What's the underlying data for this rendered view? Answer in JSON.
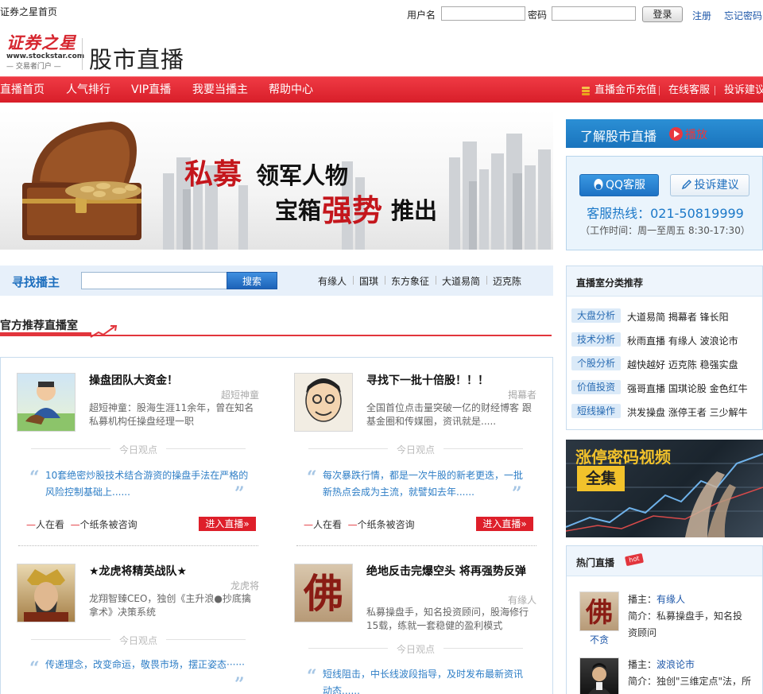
{
  "topbar": {
    "home_link": "证券之星首页",
    "username_label": "用户名",
    "password_label": "密码",
    "login_button": "登录",
    "register_link": "注册",
    "forgot_link": "忘记密码"
  },
  "header": {
    "logo_cn": "证券之星",
    "logo_url": "www.stockstar.com",
    "logo_sub": "— 交易者门户 —",
    "site_title": "股市直播"
  },
  "nav": {
    "items": [
      "直播首页",
      "人气排行",
      "VIP直播",
      "我要当播主",
      "帮助中心"
    ],
    "right_items": [
      "直播金币充值",
      "在线客服",
      "投诉建议"
    ]
  },
  "banner": {
    "line1_red": "私募",
    "line1_rest": "领军人物",
    "line2_a": "宝箱",
    "line2_red": "强势",
    "line2_b": "推出"
  },
  "search": {
    "label": "寻找播主",
    "input_value": "",
    "button": "搜索",
    "hot_keywords": [
      "有缘人",
      "国琪",
      "东方象征",
      "大道易简",
      "迈克陈"
    ]
  },
  "official": {
    "title": "官方推荐直播室",
    "view_label": "今日观点",
    "enter_button": "进入直播»",
    "cards": [
      {
        "title": "操盘团队大资金！",
        "author": "超短神童",
        "desc": "超短神童：股海生涯11余年，曾在知名私募机构任操盘经理一职",
        "quote": "10套绝密炒股技术结合游资的操盘手法在严格的风险控制基础上......",
        "stat1": "人在看",
        "stat2": "个纸条被咨询"
      },
      {
        "title": "寻找下一批十倍股！！！",
        "author": "揭幕者",
        "desc": "全国首位点击量突破一亿的财经博客 跟基金圈和传媒圈，资讯就是.....",
        "quote": "每次暴跌行情，都是一次牛股的新老更迭，一批新热点会成为主流，就譬如去年......",
        "stat1": "人在看",
        "stat2": "个纸条被咨询"
      },
      {
        "title": "★龙虎将精英战队★",
        "author": "龙虎将",
        "desc": "龙翔智臻CEO，独创《主升浪●抄底擒拿术》决策系统",
        "quote": "传递理念，改变命运，敬畏市场，摆正姿态······"
      },
      {
        "title": "绝地反击完爆空头 将再强势反弹",
        "author": "有缘人",
        "desc": "私募操盘手，知名投资顾问，股海修行15载，练就一套稳健的盈利模式",
        "quote": "短线阻击，中长线波段指导，及时发布最新资讯动态......"
      }
    ]
  },
  "learn": {
    "title": "了解股市直播",
    "play": "播放"
  },
  "service": {
    "qq_button": "QQ客服",
    "complaint_button": "投诉建议",
    "hotline": "客服热线：021-50819999",
    "hours": "（工作时间：周一至周五 8:30-17:30）"
  },
  "categories": {
    "title": "直播室分类推荐",
    "rows": [
      {
        "tag": "大盘分析",
        "names": "大道易简  揭幕者  锋长阳"
      },
      {
        "tag": "技术分析",
        "names": "秋雨直播  有缘人  波浪论市"
      },
      {
        "tag": "个股分析",
        "names": "越快越好  迈克陈  稳强实盘"
      },
      {
        "tag": "价值投资",
        "names": "强哥直播  国琪论股  金色红牛"
      },
      {
        "tag": "短线操作",
        "names": "洪发操盘  涨停王者  三少解牛"
      }
    ]
  },
  "video_ad": {
    "title": "涨停密码视频",
    "badge": "全集"
  },
  "hot": {
    "title": "热门直播",
    "badge": "hot",
    "hosts": [
      {
        "name_label": "播主：",
        "name": "有缘人",
        "intro_label": "简介：",
        "intro1": "私募操盘手，知名投",
        "intro2": "资顾问",
        "caption": "不贪"
      },
      {
        "name_label": "播主：",
        "name": "波浪论市",
        "intro_label": "简介：",
        "intro1": "独创\"三维定点\"法，所"
      }
    ]
  },
  "colors": {
    "nav_red": "#d81e29",
    "accent_blue": "#1c56a8",
    "quote_blue": "#2e7ec6"
  }
}
